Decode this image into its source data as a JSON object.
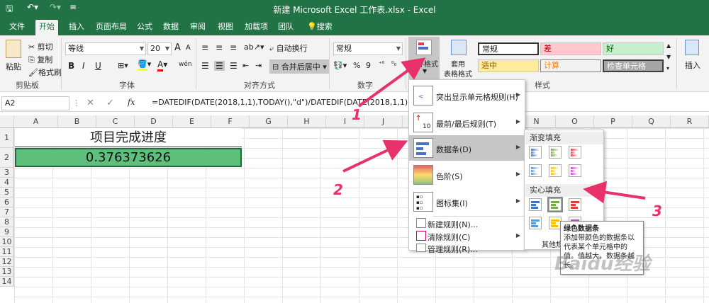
{
  "titlebar": {
    "title": "新建 Microsoft Excel 工作表.xlsx - Excel",
    "save_icon": "save-icon",
    "undo_icon": "undo-icon",
    "redo_icon": "redo-icon"
  },
  "tabs": [
    "文件",
    "开始",
    "插入",
    "页面布局",
    "公式",
    "数据",
    "审阅",
    "视图",
    "加载项",
    "团队",
    "搜索"
  ],
  "ribbon": {
    "clipboard": {
      "paste": "粘贴",
      "cut": "剪切",
      "copy": "复制",
      "format_painter": "格式刷",
      "label": "剪贴板"
    },
    "font": {
      "name": "等线",
      "size": "20",
      "bold": "B",
      "italic": "I",
      "underline": "U",
      "label": "字体",
      "grow": "A",
      "shrink": "A",
      "phonetic": "wén"
    },
    "alignment": {
      "wrap": "自动换行",
      "merge": "合并后居中",
      "label": "对齐方式"
    },
    "number": {
      "format": "常规",
      "percent": "%",
      "comma": "9",
      "label": "数字"
    },
    "styles": {
      "conditional": "条件格式",
      "table_format": "套用\n表格格式",
      "table_format_line1": "套用",
      "table_format_line2": "表格格式",
      "normal": "常规",
      "bad": "差",
      "good": "好",
      "neutral": "适中",
      "calc": "计算",
      "check": "检查单元格",
      "label": "样式"
    },
    "cells": {
      "insert": "插入"
    }
  },
  "formula_bar": {
    "name_box": "A2",
    "fx": "fx",
    "formula": "=DATEDIF(DATE(2018,1,1),TODAY(),\"d\")/DATEDIF(DATE(2018,1,1),DATE(20"
  },
  "columns": [
    "A",
    "B",
    "C",
    "D",
    "E",
    "F",
    "G",
    "H",
    "I",
    "J",
    "K",
    "L",
    "M",
    "N",
    "O",
    "P",
    "Q",
    "R"
  ],
  "rows": [
    "1",
    "2",
    "3",
    "4",
    "5",
    "6",
    "7",
    "8",
    "9",
    "10",
    "11",
    "12",
    "13",
    "14"
  ],
  "cells": {
    "title": "项目完成进度",
    "value": "0.376373626"
  },
  "cf_menu": {
    "items": [
      {
        "label": "突出显示单元格规则(H)",
        "icon": "highlight-rules-icon"
      },
      {
        "label": "最前/最后规则(T)",
        "icon": "top-bottom-rules-icon",
        "badge": "10"
      },
      {
        "label": "数据条(D)",
        "icon": "data-bars-icon"
      },
      {
        "label": "色阶(S)",
        "icon": "color-scales-icon"
      },
      {
        "label": "图标集(I)",
        "icon": "icon-sets-icon"
      },
      {
        "label": "新建规则(N)...",
        "icon": "new-rule-icon"
      },
      {
        "label": "清除规则(C)",
        "icon": "clear-rules-icon"
      },
      {
        "label": "管理规则(R)...",
        "icon": "manage-rules-icon"
      }
    ]
  },
  "databar_submenu": {
    "gradient_header": "渐变填充",
    "solid_header": "实心填充",
    "other": "其他规",
    "colors": [
      "#4472c4",
      "#70ad47",
      "#e03c3c",
      "#5b9bd5",
      "#ffc000",
      "#c74bcf"
    ]
  },
  "tooltip": {
    "title": "绿色数据条",
    "body": "添加带颜色的数据条以代表某个单元格中的值。值越大，数据条越长。"
  },
  "annotations": {
    "one": "1",
    "two": "2",
    "three": "3",
    "color": "#e8316a"
  },
  "watermark": "Baidu经验"
}
